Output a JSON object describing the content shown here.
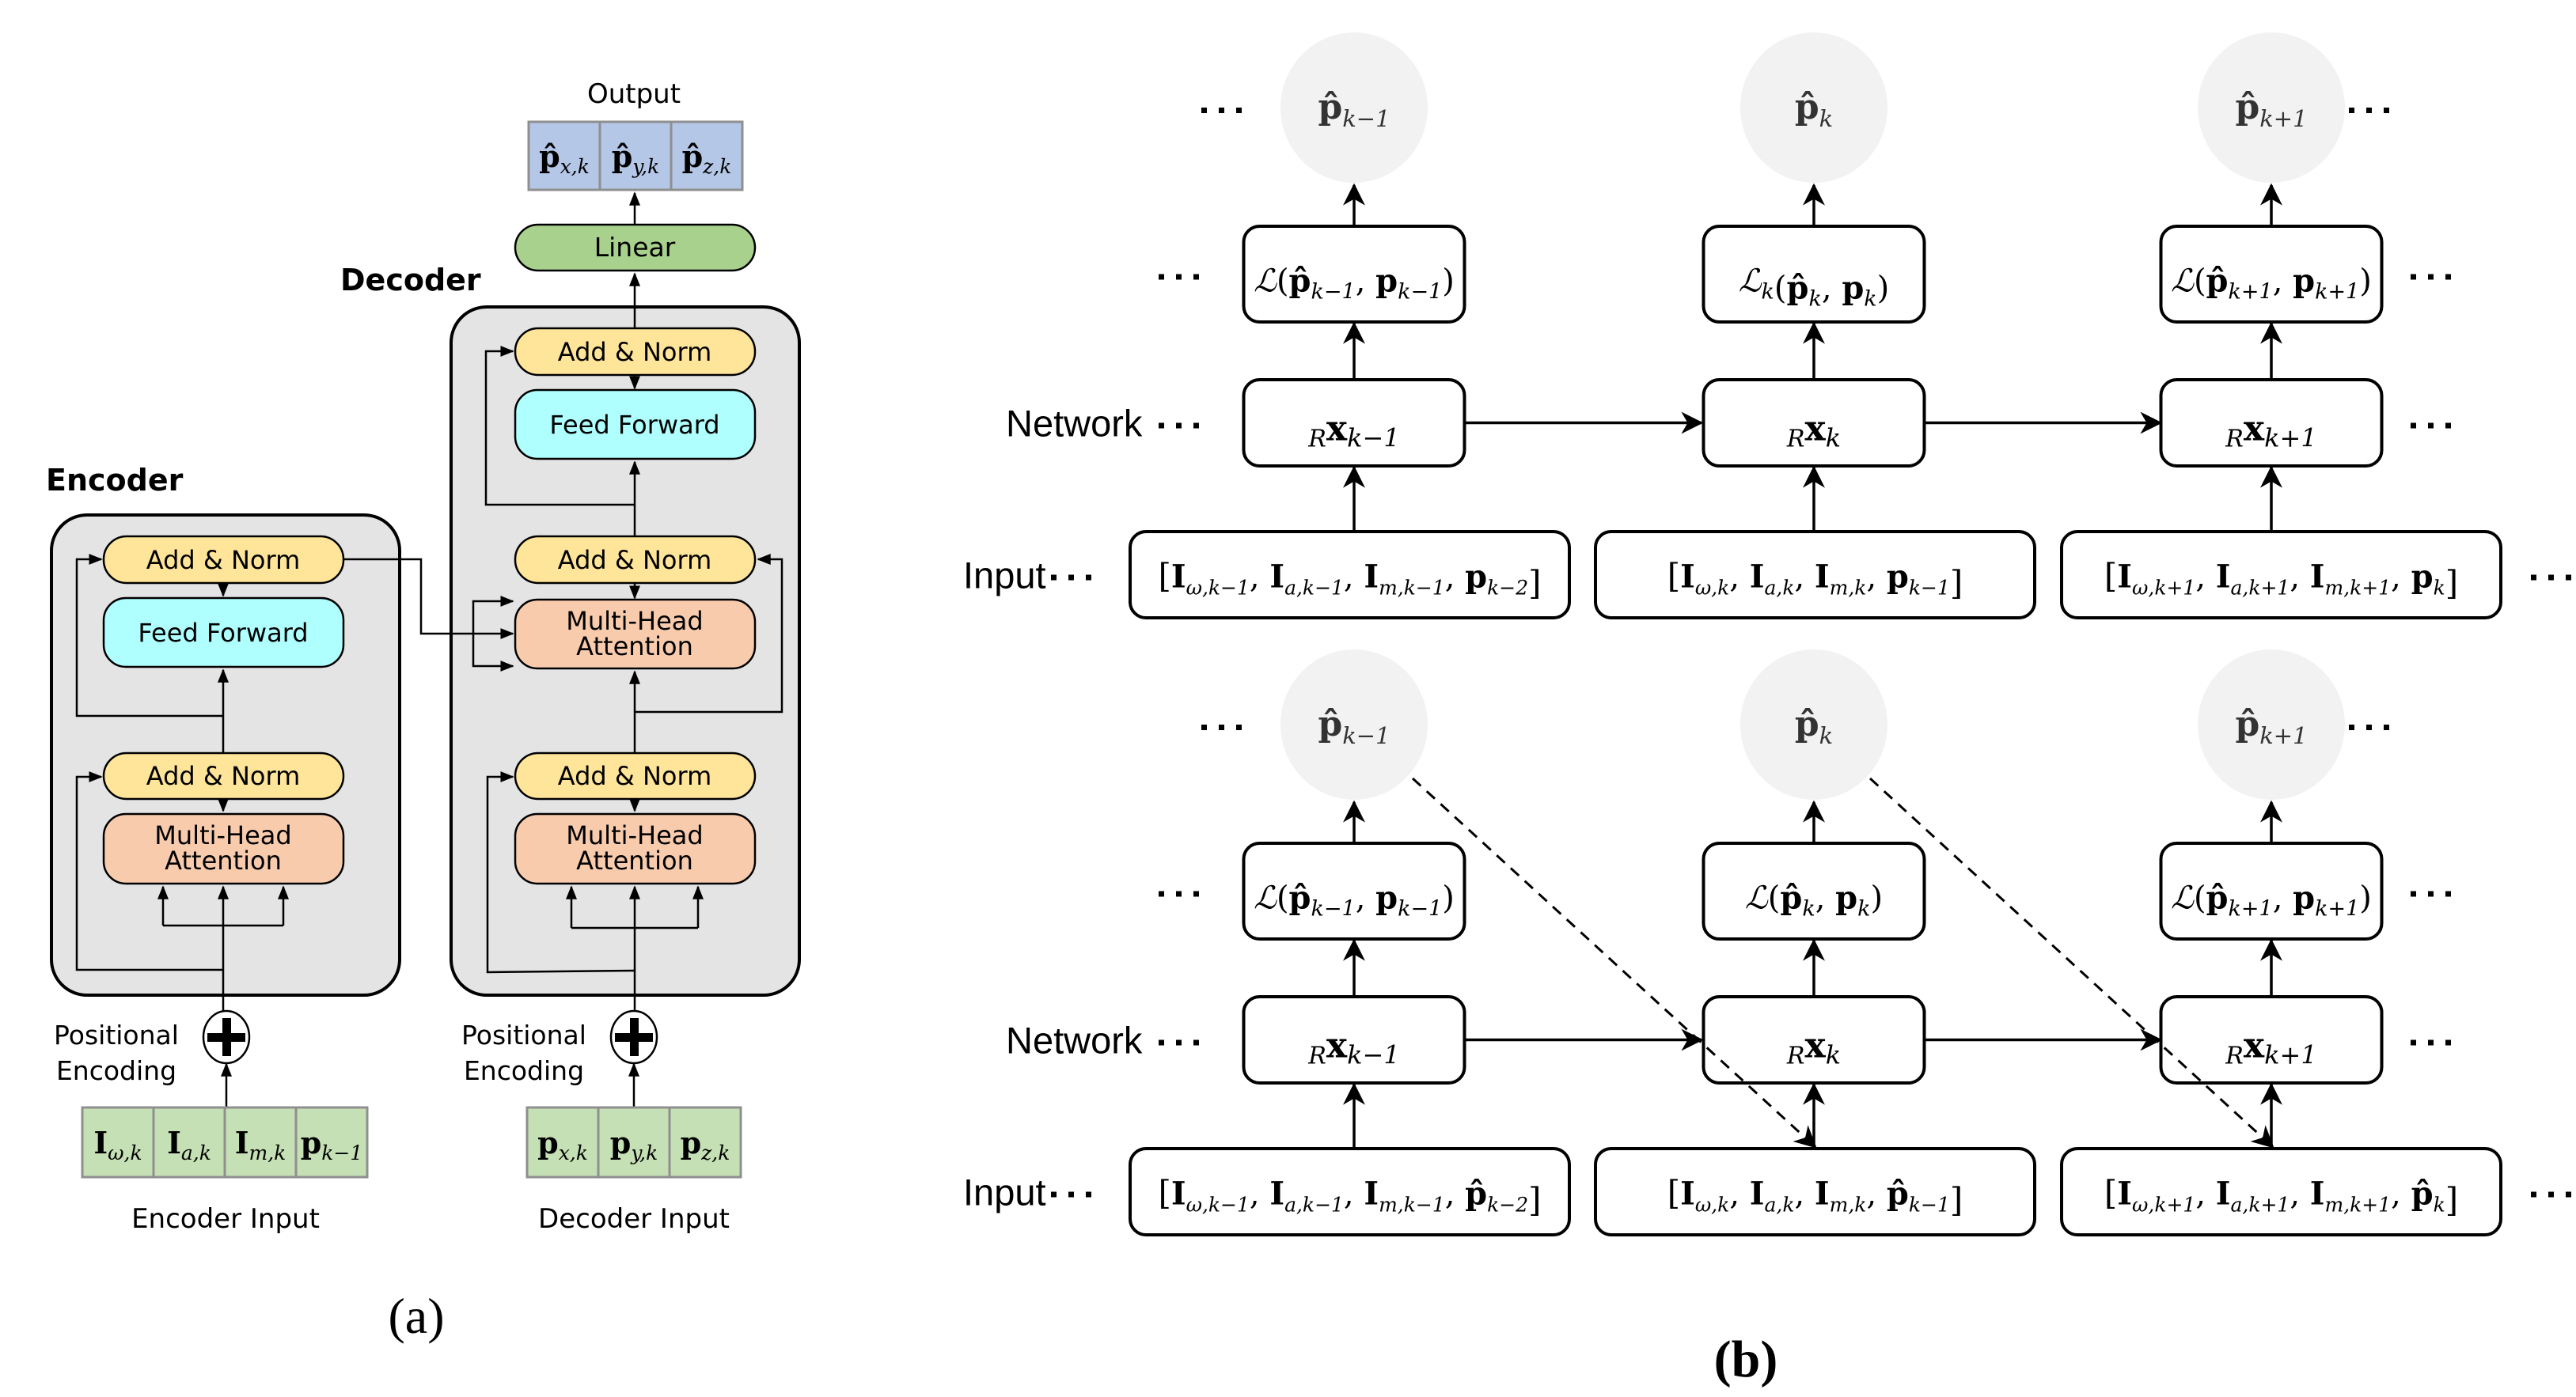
{
  "colors": {
    "add_norm": "#ffe599",
    "feed_forward": "#aefffd",
    "attention": "#f8cbad",
    "linear": "#a9d18e",
    "output_cell": "#b4c7e7",
    "input_cell": "#c5e0b4",
    "block_bg": "#e4e4e4",
    "ellipse": "#f2f2f2"
  },
  "part_a": {
    "caption": "(a)",
    "output_label": "Output",
    "output_cells": [
      {
        "base": "p̂",
        "sub": "x,k"
      },
      {
        "base": "p̂",
        "sub": "y,k"
      },
      {
        "base": "p̂",
        "sub": "z,k"
      }
    ],
    "linear_label": "Linear",
    "decoder": {
      "title": "Decoder",
      "add_norm_top": "Add & Norm",
      "feed_forward": "Feed Forward",
      "add_norm_mid": "Add & Norm",
      "cross_attention": [
        "Multi-Head",
        "Attention"
      ],
      "add_norm_bottom": "Add & Norm",
      "self_attention": [
        "Multi-Head",
        "Attention"
      ]
    },
    "encoder": {
      "title": "Encoder",
      "add_norm_top": "Add & Norm",
      "feed_forward": "Feed Forward",
      "add_norm_bottom": "Add & Norm",
      "self_attention": [
        "Multi-Head",
        "Attention"
      ]
    },
    "positional_encoding": [
      "Positional",
      "Encoding"
    ],
    "encoder_input_cells": [
      {
        "base": "I",
        "sub": "ω,k"
      },
      {
        "base": "I",
        "sub": "a,k"
      },
      {
        "base": "I",
        "sub": "m,k"
      },
      {
        "base": "p",
        "sub": "k−1"
      }
    ],
    "decoder_input_cells": [
      {
        "base": "p",
        "sub": "x,k"
      },
      {
        "base": "p",
        "sub": "y,k"
      },
      {
        "base": "p",
        "sub": "z,k"
      }
    ],
    "encoder_input_label": "Encoder Input",
    "decoder_input_label": "Decoder Input"
  },
  "part_b": {
    "caption": "(b)",
    "row_labels": {
      "network": "Network",
      "input": "Input"
    },
    "ellipsis": "· · ·",
    "top": {
      "outputs": [
        {
          "base": "p̂",
          "sub": "k−1"
        },
        {
          "base": "p̂",
          "sub": "k"
        },
        {
          "base": "p̂",
          "sub": "k+1"
        }
      ],
      "losses": [
        {
          "fn": "ℒ",
          "fn_sub": "",
          "a": "p̂",
          "a_sub": "k−1",
          "b": "p",
          "b_sub": "k−1"
        },
        {
          "fn": "ℒ",
          "fn_sub": "k",
          "a": "p̂",
          "a_sub": "k",
          "b": "p",
          "b_sub": "k"
        },
        {
          "fn": "ℒ",
          "fn_sub": "",
          "a": "p̂",
          "a_sub": "k+1",
          "b": "p",
          "b_sub": "k+1"
        }
      ],
      "networks": [
        {
          "pre": "R",
          "base": "x",
          "sub": "k−1"
        },
        {
          "pre": "R",
          "base": "x",
          "sub": "k"
        },
        {
          "pre": "R",
          "base": "x",
          "sub": "k+1"
        }
      ],
      "inputs": [
        {
          "items": [
            [
              "I",
              "ω,k−1"
            ],
            [
              "I",
              "a,k−1"
            ],
            [
              "I",
              "m,k−1"
            ],
            [
              "p",
              "k−2"
            ]
          ]
        },
        {
          "items": [
            [
              "I",
              "ω,k"
            ],
            [
              "I",
              "a,k"
            ],
            [
              "I",
              "m,k"
            ],
            [
              "p",
              "k−1"
            ]
          ]
        },
        {
          "items": [
            [
              "I",
              "ω,k+1"
            ],
            [
              "I",
              "a,k+1"
            ],
            [
              "I",
              "m,k+1"
            ],
            [
              "p",
              "k"
            ]
          ]
        }
      ]
    },
    "bottom": {
      "outputs": [
        {
          "base": "p̂",
          "sub": "k−1"
        },
        {
          "base": "p̂",
          "sub": "k"
        },
        {
          "base": "p̂",
          "sub": "k+1"
        }
      ],
      "losses": [
        {
          "fn": "ℒ",
          "fn_sub": "",
          "a": "p̂",
          "a_sub": "k−1",
          "b": "p",
          "b_sub": "k−1"
        },
        {
          "fn": "ℒ",
          "fn_sub": "",
          "a": "p̂",
          "a_sub": "k",
          "b": "p",
          "b_sub": "k"
        },
        {
          "fn": "ℒ",
          "fn_sub": "",
          "a": "p̂",
          "a_sub": "k+1",
          "b": "p",
          "b_sub": "k+1"
        }
      ],
      "networks": [
        {
          "pre": "R",
          "base": "x",
          "sub": "k−1"
        },
        {
          "pre": "R",
          "base": "x",
          "sub": "k"
        },
        {
          "pre": "R",
          "base": "x",
          "sub": "k+1"
        }
      ],
      "inputs": [
        {
          "items": [
            [
              "I",
              "ω,k−1"
            ],
            [
              "I",
              "a,k−1"
            ],
            [
              "I",
              "m,k−1"
            ],
            [
              "p̂",
              "k−2"
            ]
          ]
        },
        {
          "items": [
            [
              "I",
              "ω,k"
            ],
            [
              "I",
              "a,k"
            ],
            [
              "I",
              "m,k"
            ],
            [
              "p̂",
              "k−1"
            ]
          ]
        },
        {
          "items": [
            [
              "I",
              "ω,k+1"
            ],
            [
              "I",
              "a,k+1"
            ],
            [
              "I",
              "m,k+1"
            ],
            [
              "p̂",
              "k"
            ]
          ]
        }
      ]
    }
  }
}
